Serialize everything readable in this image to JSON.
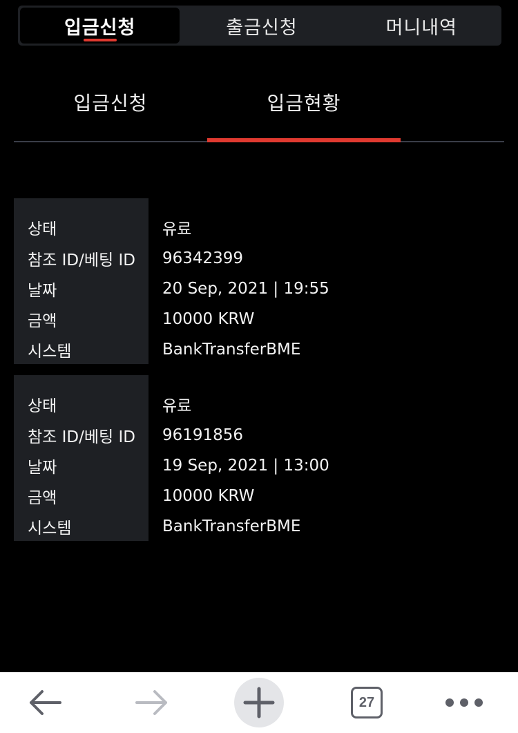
{
  "top_tabs": [
    {
      "label": "입금신청"
    },
    {
      "label": "출금신청"
    },
    {
      "label": "머니내역"
    }
  ],
  "sub_tabs": [
    {
      "label": "입금신청"
    },
    {
      "label": "입금현황"
    }
  ],
  "records": [
    {
      "rows": [
        {
          "label": "상태",
          "value": "유료"
        },
        {
          "label": "참조 ID/베팅 ID",
          "value": "96342399"
        },
        {
          "label": "날짜",
          "value": "20 Sep, 2021 | 19:55"
        },
        {
          "label": "금액",
          "value": "10000 KRW"
        },
        {
          "label": "시스템",
          "value": "BankTransferBME"
        }
      ]
    },
    {
      "rows": [
        {
          "label": "상태",
          "value": "유료"
        },
        {
          "label": "참조 ID/베팅 ID",
          "value": "96191856"
        },
        {
          "label": "날짜",
          "value": "19 Sep, 2021 | 13:00"
        },
        {
          "label": "금액",
          "value": "10000 KRW"
        },
        {
          "label": "시스템",
          "value": "BankTransferBME"
        }
      ]
    }
  ],
  "browser_bar": {
    "tab_count": "27",
    "icons": [
      "back-arrow-icon",
      "forward-arrow-icon",
      "new-tab-plus-icon",
      "tab-switcher-icon",
      "more-dots-icon"
    ]
  },
  "colors": {
    "accent": "#e03a30",
    "panel": "#1e2024",
    "background": "#000000"
  }
}
